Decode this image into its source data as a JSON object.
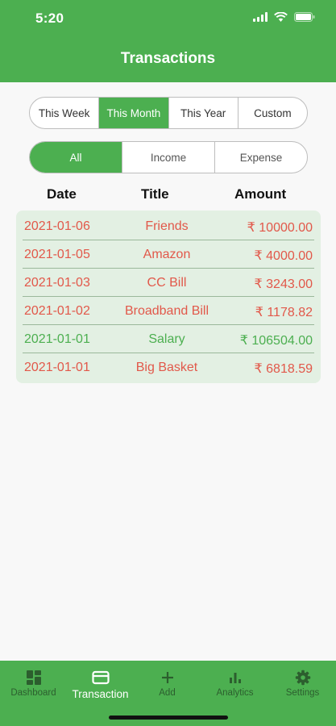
{
  "status_bar": {
    "time": "5:20"
  },
  "header": {
    "title": "Transactions"
  },
  "period_filter": {
    "options": [
      "This Week",
      "This Month",
      "This Year",
      "Custom"
    ],
    "selected": "This Month"
  },
  "type_filter": {
    "options": [
      "All",
      "Income",
      "Expense"
    ],
    "selected": "All"
  },
  "table": {
    "headers": {
      "date": "Date",
      "title": "Title",
      "amount": "Amount"
    },
    "rows": [
      {
        "date": "2021-01-06",
        "title": "Friends",
        "amount": "₹ 10000.00",
        "kind": "expense"
      },
      {
        "date": "2021-01-05",
        "title": "Amazon",
        "amount": "₹ 4000.00",
        "kind": "expense"
      },
      {
        "date": "2021-01-03",
        "title": "CC Bill",
        "amount": "₹ 3243.00",
        "kind": "expense"
      },
      {
        "date": "2021-01-02",
        "title": "Broadband Bill",
        "amount": "₹ 1178.82",
        "kind": "expense"
      },
      {
        "date": "2021-01-01",
        "title": "Salary",
        "amount": "₹ 106504.00",
        "kind": "income"
      },
      {
        "date": "2021-01-01",
        "title": "Big Basket",
        "amount": "₹ 6818.59",
        "kind": "expense"
      }
    ]
  },
  "bottom_nav": {
    "items": [
      {
        "label": "Dashboard",
        "icon": "dashboard-icon"
      },
      {
        "label": "Transaction",
        "icon": "card-icon"
      },
      {
        "label": "Add",
        "icon": "plus-icon"
      },
      {
        "label": "Analytics",
        "icon": "bar-chart-icon"
      },
      {
        "label": "Settings",
        "icon": "gear-icon"
      }
    ],
    "selected": "Transaction"
  },
  "colors": {
    "primary": "#4caf50",
    "expense": "#e2584a",
    "income": "#4caf50",
    "table_bg": "#e3f0e3"
  }
}
